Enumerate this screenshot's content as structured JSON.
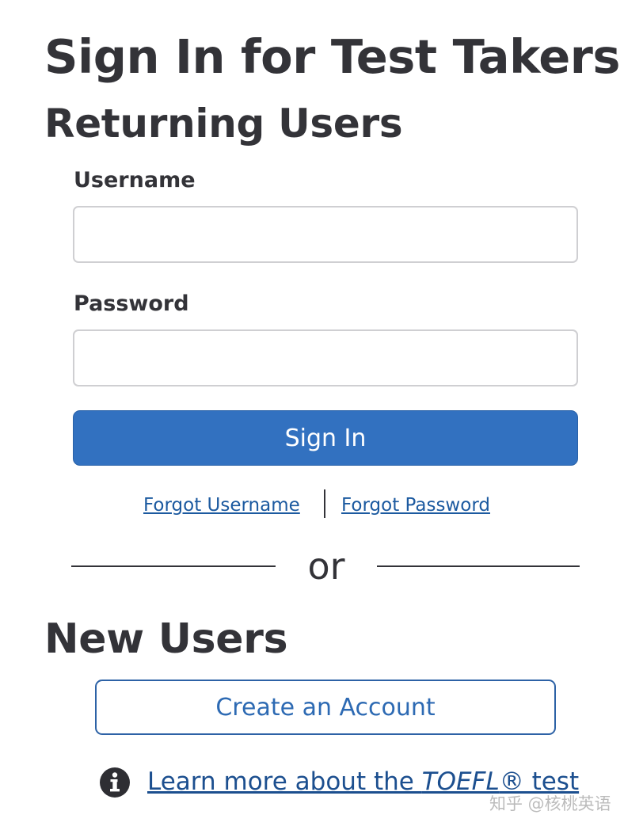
{
  "page": {
    "title": "Sign In for Test Takers"
  },
  "returning": {
    "heading": "Returning Users",
    "username_label": "Username",
    "username_value": "",
    "password_label": "Password",
    "password_value": "",
    "signin_label": "Sign In",
    "forgot_username": "Forgot Username",
    "forgot_password": "Forgot Password"
  },
  "divider": {
    "text": "or"
  },
  "new_users": {
    "heading": "New Users",
    "create_label": "Create an Account"
  },
  "learn_more": {
    "prefix": "Learn more about the ",
    "emphasis": "TOEFL",
    "suffix": "® test",
    "icon": "info-circle-icon"
  },
  "watermark": {
    "text": "知乎 @核桃英语"
  },
  "colors": {
    "text": "#333338",
    "primary_button": "#3271c0",
    "link": "#1c5aa0",
    "outline_button": "#2d62a6"
  }
}
